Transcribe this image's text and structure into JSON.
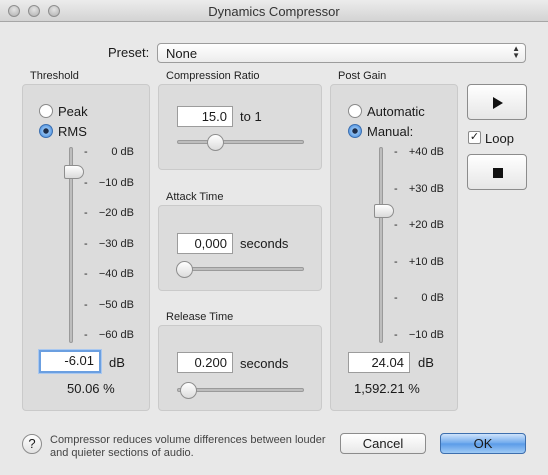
{
  "window": {
    "title": "Dynamics Compressor"
  },
  "preset": {
    "label": "Preset:",
    "value": "None"
  },
  "threshold": {
    "title": "Threshold",
    "peak_label": "Peak",
    "rms_label": "RMS",
    "selected": "RMS",
    "ticks": [
      "0 dB",
      "−10 dB",
      "−20 dB",
      "−30 dB",
      "−40 dB",
      "−50 dB",
      "−60 dB"
    ],
    "value": "-6.01",
    "unit": "dB",
    "percent": "50.06 %"
  },
  "compression_ratio": {
    "title": "Compression Ratio",
    "value": "15.0",
    "suffix": "to 1"
  },
  "attack_time": {
    "title": "Attack Time",
    "value": "0,000",
    "unit": "seconds"
  },
  "release_time": {
    "title": "Release Time",
    "value": "0.200",
    "unit": "seconds"
  },
  "post_gain": {
    "title": "Post Gain",
    "automatic_label": "Automatic",
    "manual_label": "Manual:",
    "selected": "Manual:",
    "ticks": [
      "+40 dB",
      "+30 dB",
      "+20 dB",
      "+10 dB",
      "0 dB",
      "−10 dB"
    ],
    "value": "24.04",
    "unit": "dB",
    "percent": "1,592.21 %"
  },
  "transport": {
    "loop_label": "Loop",
    "loop_checked": true
  },
  "footer": {
    "help_text": "Compressor reduces volume differences between louder and quieter sections of audio.",
    "cancel_label": "Cancel",
    "ok_label": "OK"
  }
}
